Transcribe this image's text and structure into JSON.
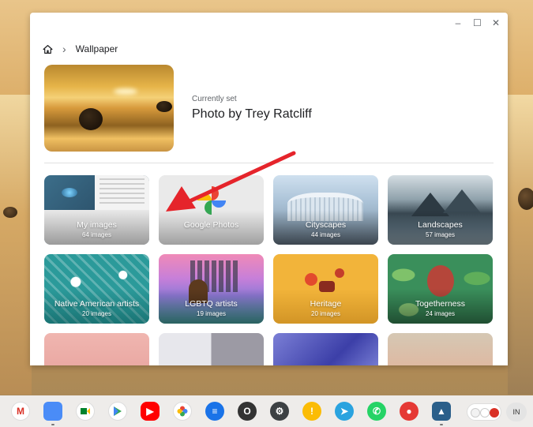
{
  "window": {
    "controls": {
      "minimize": "–",
      "maximize": "☐",
      "close": "✕"
    },
    "breadcrumb": {
      "current": "Wallpaper"
    }
  },
  "current_wallpaper": {
    "label": "Currently set",
    "title": "Photo by Trey Ratcliff"
  },
  "collections": [
    {
      "name": "My images",
      "count": "64 images"
    },
    {
      "name": "Google Photos",
      "count": ""
    },
    {
      "name": "Cityscapes",
      "count": "44 images"
    },
    {
      "name": "Landscapes",
      "count": "57 images"
    },
    {
      "name": "Native American artists",
      "count": "20 images"
    },
    {
      "name": "LGBTQ artists",
      "count": "19 images"
    },
    {
      "name": "Heritage",
      "count": "20 images"
    },
    {
      "name": "Togetherness",
      "count": "24 images"
    }
  ],
  "shelf": {
    "apps": [
      "gmail-icon",
      "files-icon",
      "meet-icon",
      "play-store-icon",
      "youtube-icon",
      "google-photos-icon",
      "messages-icon",
      "launcher-icon",
      "settings-icon",
      "keep-icon",
      "telegram-icon",
      "whatsapp-icon",
      "paint-icon",
      "wallpaper-app-icon"
    ],
    "launcher_glyph": "O",
    "ime_indicator": "IN"
  },
  "colors": {
    "accent": "#e5242b",
    "window_bg": "#ffffff"
  }
}
